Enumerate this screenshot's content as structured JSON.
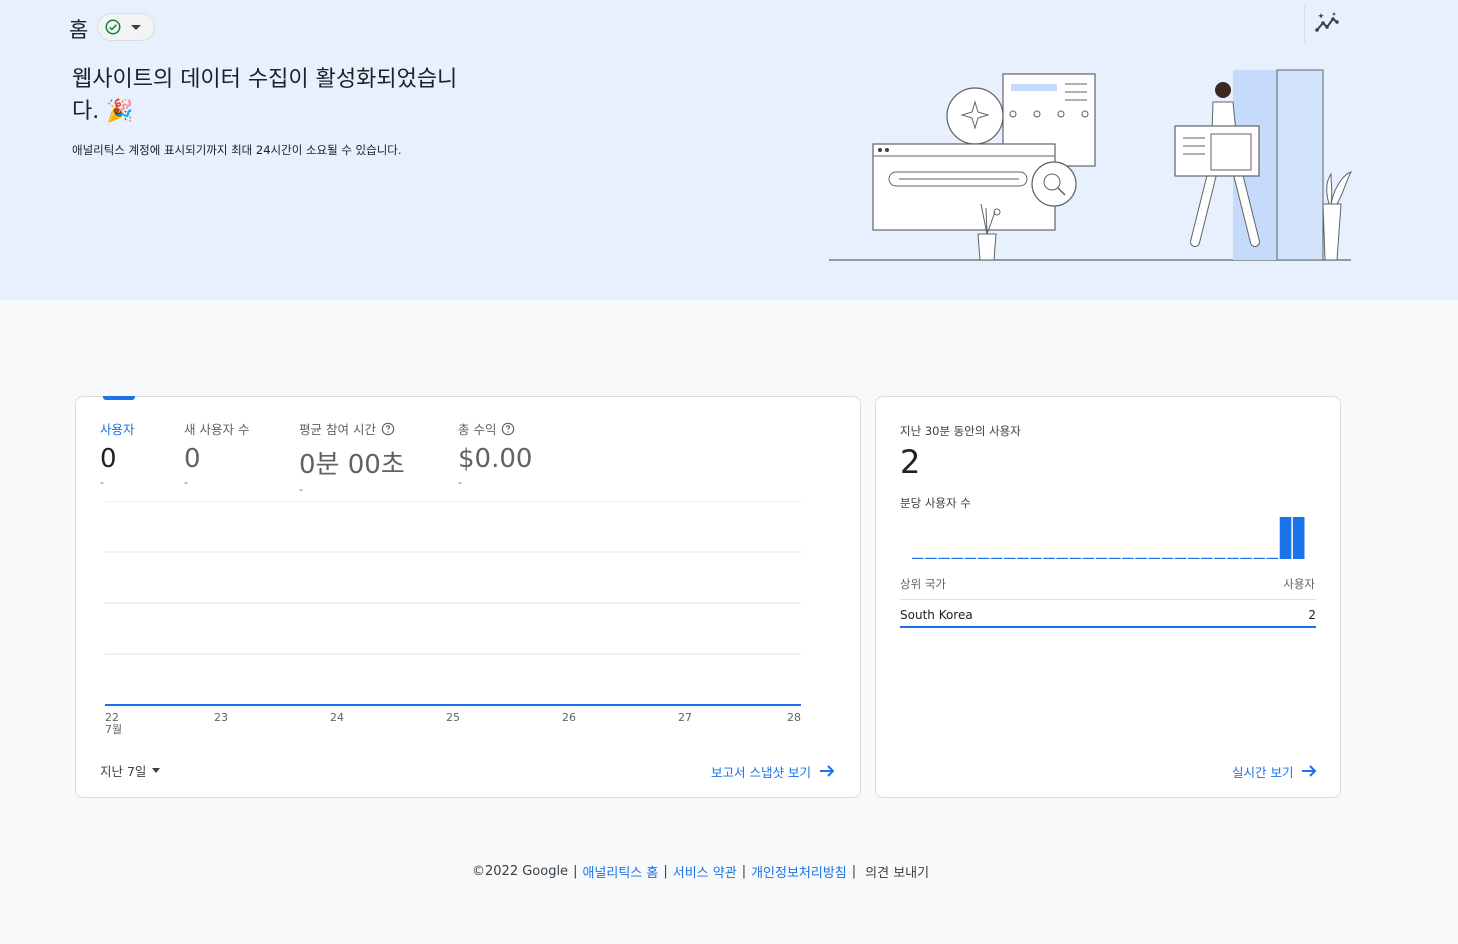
{
  "header": {
    "title": "홈",
    "status_icon": "check-circle-icon",
    "insights_icon": "insights-icon"
  },
  "hero": {
    "heading": "웹사이트의 데이터 수집이 활성화되었습니다. 🎉",
    "subtitle": "애널리틱스 계정에 표시되기까지 최대 24시간이 소요될 수 있습니다."
  },
  "overview": {
    "metrics": [
      {
        "label": "사용자",
        "value": "0",
        "delta": "-"
      },
      {
        "label": "새 사용자 수",
        "value": "0",
        "delta": "-"
      },
      {
        "label": "평균 참여 시간",
        "value": "0분 00초",
        "delta": "-"
      },
      {
        "label": "총 수익",
        "value": "$0.00",
        "delta": "-"
      }
    ],
    "date_range": "지난 7일",
    "snapshot_link": "보고서 스냅샷 보기"
  },
  "chart_data": {
    "type": "line",
    "x": [
      "22",
      "23",
      "24",
      "25",
      "26",
      "27",
      "28"
    ],
    "x_sublabel": "7월",
    "series": [
      {
        "values": [
          0,
          0,
          0,
          0,
          0,
          0,
          0
        ],
        "color": "#1a73e8"
      }
    ],
    "grid": true,
    "ylim": [
      0,
      4
    ]
  },
  "realtime": {
    "title": "지난 30분 동안의 사용자",
    "value": "2",
    "per_minute_label": "분당 사용자 수",
    "per_minute_values": [
      0,
      0,
      0,
      0,
      0,
      0,
      0,
      0,
      0,
      0,
      0,
      0,
      0,
      0,
      0,
      0,
      0,
      0,
      0,
      0,
      0,
      0,
      0,
      0,
      0,
      0,
      0,
      0,
      1,
      1
    ],
    "col_country": "상위 국가",
    "col_users": "사용자",
    "rows": [
      {
        "country": "South Korea",
        "users": "2"
      }
    ],
    "realtime_link": "실시간 보기",
    "bar_color": "#1a73e8"
  },
  "footer": {
    "copyright": "©2022 Google",
    "links": [
      "애널리틱스 홈",
      "서비스 약관",
      "개인정보처리방침"
    ],
    "feedback": "의견 보내기"
  }
}
